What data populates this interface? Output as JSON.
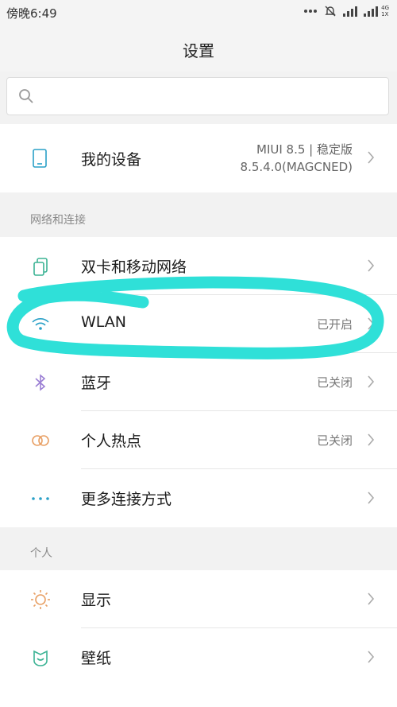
{
  "status_bar": {
    "time": "傍晚6:49",
    "net_top": "4G",
    "net_bottom": "1X"
  },
  "header": {
    "title": "设置"
  },
  "search": {
    "value": "",
    "placeholder": ""
  },
  "device": {
    "label": "我的设备",
    "version_line1": "MIUI 8.5 | 稳定版",
    "version_line2": "8.5.4.0(MAGCNED)"
  },
  "network_section": {
    "header": "网络和连接",
    "items": [
      {
        "label": "双卡和移动网络",
        "value": "",
        "icon": "sim-card-icon"
      },
      {
        "label": "WLAN",
        "value": "已开启",
        "icon": "wifi-icon"
      },
      {
        "label": "蓝牙",
        "value": "已关闭",
        "icon": "bluetooth-icon"
      },
      {
        "label": "个人热点",
        "value": "已关闭",
        "icon": "hotspot-icon"
      },
      {
        "label": "更多连接方式",
        "value": "",
        "icon": "more-dots-icon"
      }
    ]
  },
  "personal_section": {
    "header": "个人",
    "items": [
      {
        "label": "显示",
        "icon": "sun-icon"
      },
      {
        "label": "壁纸",
        "icon": "wallpaper-icon"
      }
    ]
  },
  "colors": {
    "highlight": "#2fe0d8",
    "accent_icon": "#2aa0c7"
  }
}
